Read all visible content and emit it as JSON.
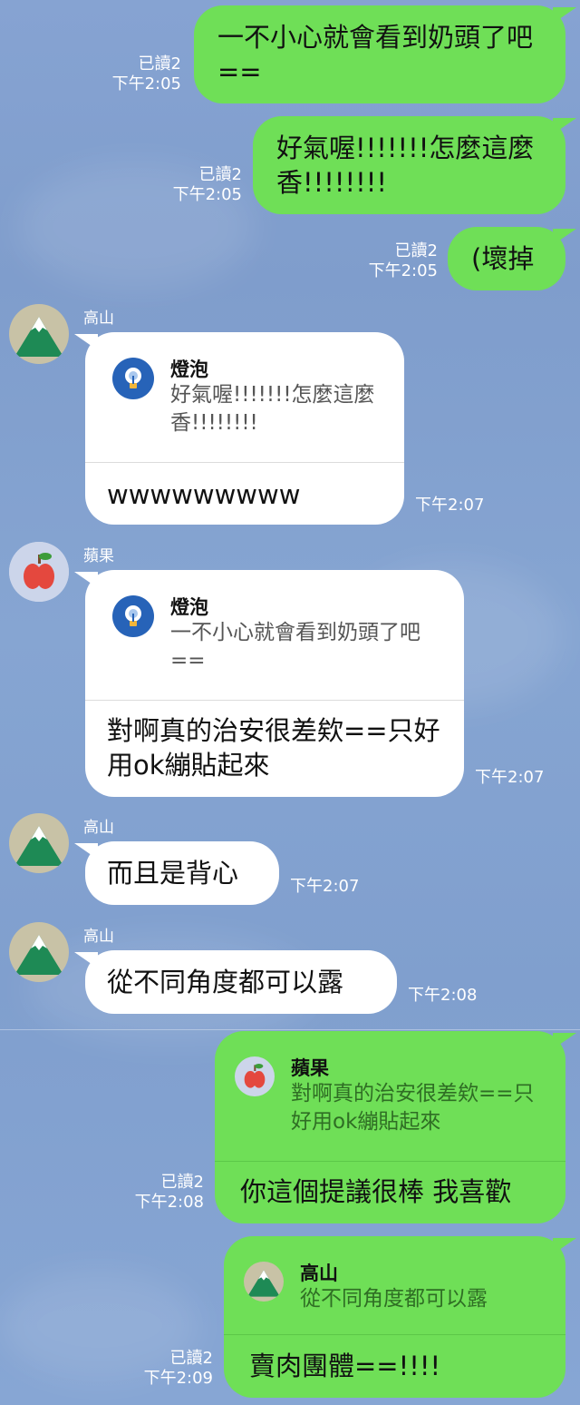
{
  "chat": {
    "messages": [
      {
        "side": "out",
        "text": "一不小心就會看到奶頭了吧==",
        "read": "已讀2",
        "time": "下午2:05"
      },
      {
        "side": "out",
        "text": "好氣喔!!!!!!!怎麼這麼香!!!!!!!!",
        "read": "已讀2",
        "time": "下午2:05"
      },
      {
        "side": "out",
        "text": "(壞掉",
        "read": "已讀2",
        "time": "下午2:05"
      },
      {
        "side": "in",
        "sender": "高山",
        "reply_to": {
          "name": "燈泡",
          "quote": "好氣喔!!!!!!!怎麼這麼香!!!!!!!!"
        },
        "text": "wwwwwwwww",
        "time": "下午2:07"
      },
      {
        "side": "in",
        "sender": "蘋果",
        "reply_to": {
          "name": "燈泡",
          "quote": "一不小心就會看到奶頭了吧=="
        },
        "text": "對啊真的治安很差欸==只好用ok繃貼起來",
        "time": "下午2:07"
      },
      {
        "side": "in",
        "sender": "高山",
        "text": "而且是背心",
        "time": "下午2:07"
      },
      {
        "side": "in",
        "sender": "高山",
        "text": "從不同角度都可以露",
        "time": "下午2:08"
      },
      {
        "side": "out",
        "reply_to": {
          "name": "蘋果",
          "quote": "對啊真的治安很差欸==只好用ok繃貼起來"
        },
        "text": "你這個提議很棒 我喜歡",
        "read": "已讀2",
        "time": "下午2:08"
      },
      {
        "side": "out",
        "reply_to": {
          "name": "高山",
          "quote": "從不同角度都可以露"
        },
        "text": "賣肉團體==!!!!",
        "read": "已讀2",
        "time": "下午2:09"
      }
    ]
  },
  "icons": {
    "mountain": "mountain-avatar-icon",
    "apple": "apple-avatar-icon",
    "bulb": "lightbulb-avatar-icon"
  },
  "colors": {
    "outgoing_bubble": "#6fdf57",
    "incoming_bubble": "#ffffff",
    "background": "#86a3d2",
    "bulb_avatar": "#2763b8"
  }
}
